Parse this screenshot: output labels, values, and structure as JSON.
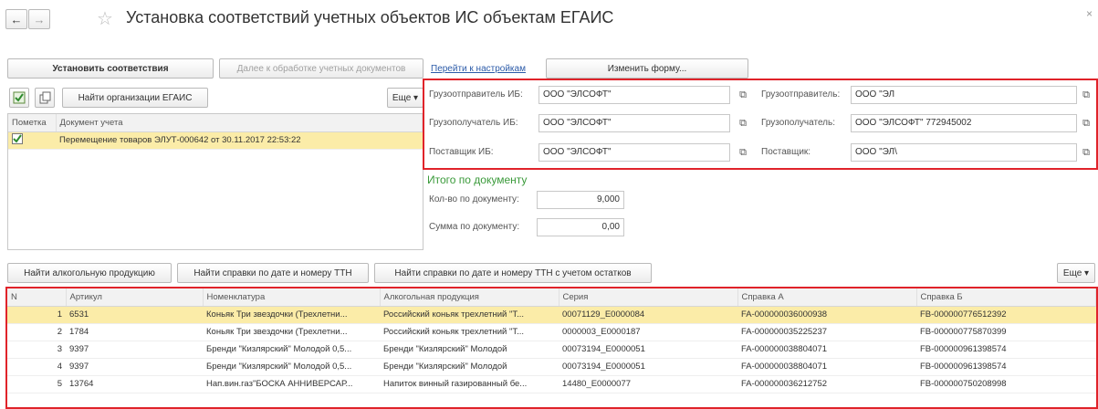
{
  "nav": {
    "back": "←",
    "forward": "→",
    "star": "☆"
  },
  "title": "Установка соответствий учетных объектов ИС объектам ЕГАИС",
  "top_buttons": {
    "set_match": "Установить соответствия",
    "next_docs": "Далее к обработке учетных документов",
    "settings_link": "Перейти к настройкам",
    "change_form": "Изменить форму..."
  },
  "left_toolbar": {
    "find_orgs": "Найти организации ЕГАИС",
    "more": "Еще"
  },
  "doc_table": {
    "headers": [
      "Пометка",
      "Документ учета"
    ],
    "rows": [
      {
        "doc": "Перемещение товаров ЭЛУТ-000642 от 30.11.2017 22:53:22"
      }
    ]
  },
  "parties": {
    "shipper_is_label": "Грузоотправитель ИБ:",
    "shipper_is_value": "ООО \"ЭЛСОФТ\"",
    "consignee_is_label": "Грузополучатель ИБ:",
    "consignee_is_value": "ООО \"ЭЛСОФТ\"",
    "supplier_is_label": "Поставщик ИБ:",
    "supplier_is_value": "ООО \"ЭЛСОФТ\"",
    "shipper_label": "Грузоотправитель:",
    "shipper_value": "ООО \"ЭЛ",
    "consignee_label": "Грузополучатель:",
    "consignee_value": "ООО \"ЭЛСОФТ\" 772945002",
    "supplier_label": "Поставщик:",
    "supplier_value": "ООО \"ЭЛ\\"
  },
  "totals": {
    "heading": "Итого по документу",
    "qty_label": "Кол-во по документу:",
    "qty_value": "9,000",
    "sum_label": "Сумма по документу:",
    "sum_value": "0,00"
  },
  "bottom_toolbar": {
    "find_alco": "Найти алкогольную продукцию",
    "find_refs": "Найти справки по дате и номеру ТТН",
    "find_refs_rest": "Найти справки по дате и номеру ТТН с учетом остатков",
    "more": "Еще"
  },
  "items_table": {
    "headers": [
      "N",
      "Артикул",
      "Номенклатура",
      "Алкогольная продукция",
      "Серия",
      "Справка А",
      "Справка Б"
    ],
    "rows": [
      [
        "1",
        "6531",
        "Коньяк Три звездочки (Трехлетни...",
        "Российский коньяк трехлетний \"Т...",
        "00071129_E0000084",
        "FA-000000036000938",
        "FB-000000776512392"
      ],
      [
        "2",
        "1784",
        "Коньяк Три звездочки (Трехлетни...",
        "Российский коньяк трехлетний \"Т...",
        "0000003_E0000187",
        "FA-000000035225237",
        "FB-000000775870399"
      ],
      [
        "3",
        "9397",
        "Бренди \"Кизлярский\" Молодой 0,5...",
        "Бренди \"Кизлярский\" Молодой",
        "00073194_E0000051",
        "FA-000000038804071",
        "FB-000000961398574"
      ],
      [
        "4",
        "9397",
        "Бренди \"Кизлярский\" Молодой 0,5...",
        "Бренди \"Кизлярский\" Молодой",
        "00073194_E0000051",
        "FA-000000038804071",
        "FB-000000961398574"
      ],
      [
        "5",
        "13764",
        "Нап.вин.газ\"БОСКА АННИВЕРСАР...",
        "Напиток винный газированный бе...",
        "14480_E0000077",
        "FA-000000036212752",
        "FB-000000750208998"
      ]
    ]
  },
  "colors": {
    "accent_red": "#e0232a",
    "selection": "#fbeca8",
    "green_heading": "#3a9a3a",
    "link": "#2b5aa8"
  },
  "icons": [
    "back-arrow-icon",
    "forward-arrow-icon",
    "star-icon",
    "check-icon",
    "copy-icon",
    "select-icon",
    "close-icon"
  ]
}
